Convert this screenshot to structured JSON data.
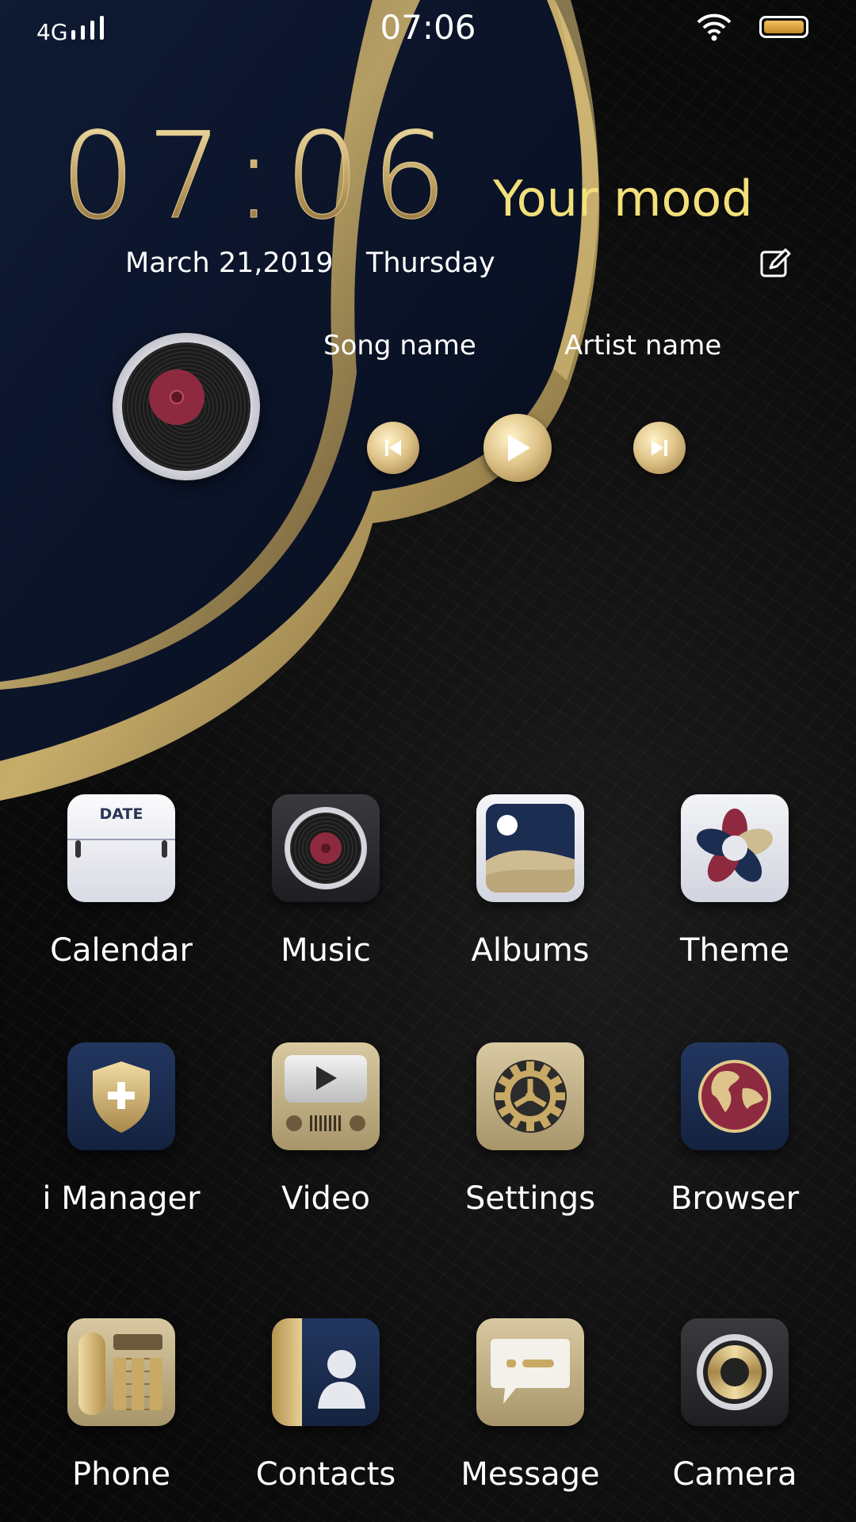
{
  "status_bar": {
    "network": "4G",
    "time": "07:06"
  },
  "widget": {
    "clock": "07:06",
    "mood": "Your mood",
    "date": "March 21,2019",
    "weekday": "Thursday",
    "song_name": "Song name",
    "artist_name": "Artist name"
  },
  "apps": [
    {
      "label": "Calendar",
      "icon": "calendar-icon",
      "icon_text": "DATE"
    },
    {
      "label": "Music",
      "icon": "music-icon"
    },
    {
      "label": "Albums",
      "icon": "albums-icon"
    },
    {
      "label": "Theme",
      "icon": "theme-icon"
    },
    {
      "label": "i Manager",
      "icon": "shield-icon"
    },
    {
      "label": "Video",
      "icon": "video-icon"
    },
    {
      "label": "Settings",
      "icon": "gear-icon"
    },
    {
      "label": "Browser",
      "icon": "globe-icon"
    },
    {
      "label": "Phone",
      "icon": "phone-icon"
    },
    {
      "label": "Contacts",
      "icon": "contacts-icon"
    },
    {
      "label": "Message",
      "icon": "message-icon"
    },
    {
      "label": "Camera",
      "icon": "camera-icon"
    }
  ],
  "colors": {
    "accent_gold": "#c9b37c",
    "mood_yellow": "#f3e07a",
    "navy": "#1c2d52",
    "wine_red": "#8e2a3f"
  }
}
